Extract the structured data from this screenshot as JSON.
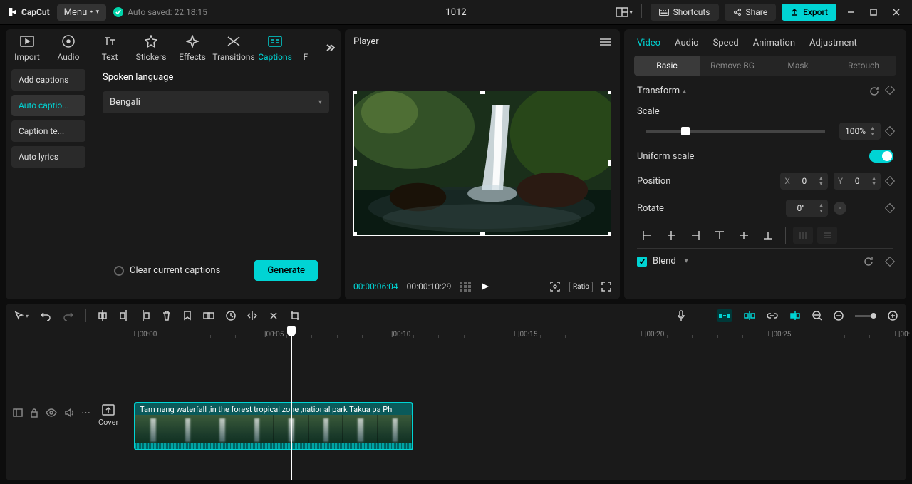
{
  "app": {
    "name": "CapCut",
    "menu": "Menu",
    "autosave": "Auto saved: 22:18:15",
    "title": "1012"
  },
  "topButtons": {
    "shortcuts": "Shortcuts",
    "share": "Share",
    "export": "Export"
  },
  "toolTabs": [
    "Import",
    "Audio",
    "Text",
    "Stickers",
    "Effects",
    "Transitions",
    "Captions",
    "F"
  ],
  "captionSidebar": [
    "Add captions",
    "Auto captio...",
    "Caption te...",
    "Auto lyrics"
  ],
  "spokenLanguage": {
    "label": "Spoken language",
    "value": "Bengali"
  },
  "clearCaptions": "Clear current captions",
  "generate": "Generate",
  "player": {
    "label": "Player",
    "current": "00:00:06:04",
    "total": "00:00:10:29",
    "ratio": "Ratio"
  },
  "rightTabs": [
    "Video",
    "Audio",
    "Speed",
    "Animation",
    "Adjustment"
  ],
  "rightSubTabs": [
    "Basic",
    "Remove BG",
    "Mask",
    "Retouch"
  ],
  "transform": {
    "label": "Transform",
    "scaleLabel": "Scale",
    "scaleValue": "100%",
    "uniformLabel": "Uniform scale",
    "positionLabel": "Position",
    "x": "0",
    "y": "0",
    "rotateLabel": "Rotate",
    "rotateValue": "0°",
    "blendLabel": "Blend"
  },
  "ruler": [
    "00:00",
    "00:05",
    "00:10",
    "00:15",
    "00:20",
    "00:25",
    "00:"
  ],
  "clip": {
    "label": "Tam nang waterfall ,in the forest tropical zone ,national park Takua pa Ph"
  },
  "cover": "Cover"
}
